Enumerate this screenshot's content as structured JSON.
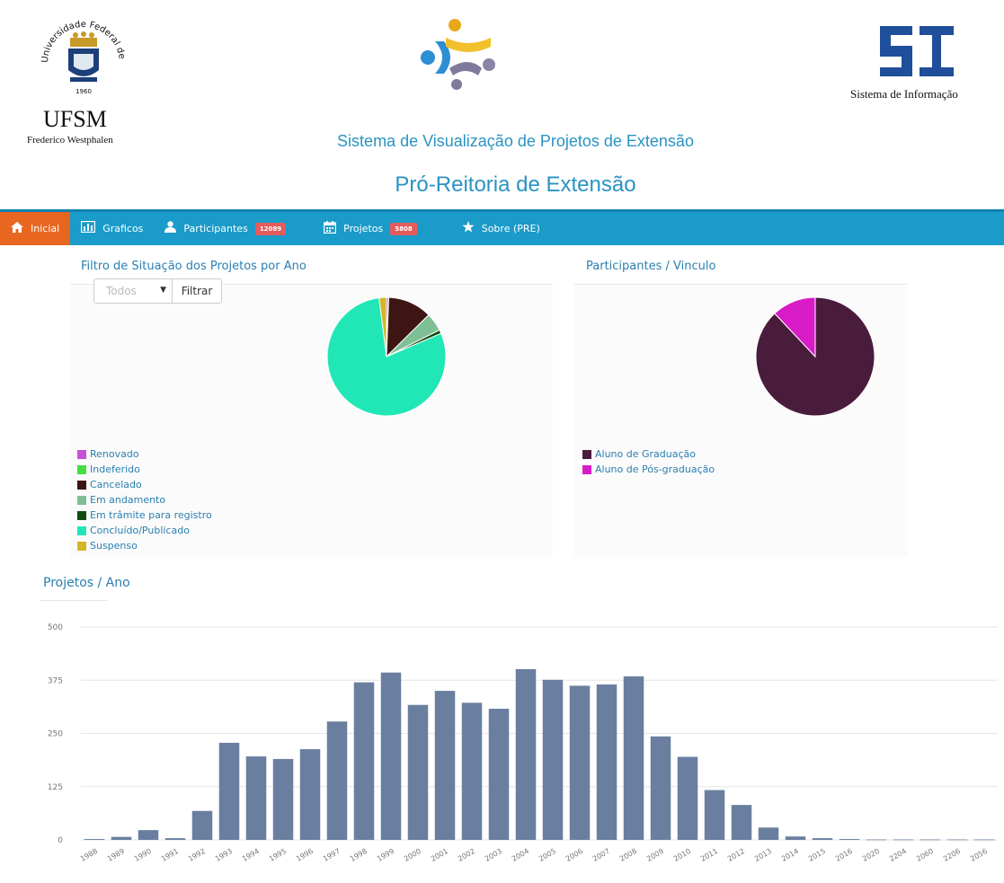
{
  "header": {
    "ufsm_title": "UFSM",
    "ufsm_campus": "Frederico Westphalen",
    "ufsm_seal_text": "Universidade Federal de Santa Maria",
    "ufsm_seal_year": "1960",
    "si_caption": "Sistema de Informação",
    "system_title": "Sistema de Visualização de Projetos de Extensão",
    "system_subtitle": "Pró-Reitoria de Extensão"
  },
  "navbar": {
    "items": [
      {
        "label": "Inicial",
        "icon": "home-icon",
        "active": true
      },
      {
        "label": "Graficos",
        "icon": "chart-icon"
      },
      {
        "label": "Participantes",
        "icon": "user-icon",
        "badge": "12089"
      },
      {
        "label": "Projetos",
        "icon": "calendar-icon",
        "badge": "5808"
      },
      {
        "label": "Sobre (PRE)",
        "icon": "star-icon"
      }
    ],
    "colors": {
      "bar": "#1a9bc9",
      "active": "#e8661f",
      "badge": "#e45c5c"
    }
  },
  "situacao_panel": {
    "title": "Filtro de Situação dos Projetos por Ano",
    "select_value": "Todos",
    "filter_button": "Filtrar"
  },
  "vinculo_panel": {
    "title": "Participantes / Vinculo"
  },
  "anos_panel": {
    "title": "Projetos / Ano"
  },
  "chart_data": [
    {
      "type": "pie",
      "labels": [
        "Renovado",
        "Indeferido",
        "Cancelado",
        "Em andamento",
        "Em trâmite para registro",
        "Concluído/Publicado",
        "Suspenso"
      ],
      "values": [
        0.5,
        0.1,
        12,
        5,
        1,
        79.4,
        2
      ],
      "colors": [
        "#c94fd6",
        "#44dd44",
        "#3d1613",
        "#7fbf96",
        "#0e4d0e",
        "#21e7b6",
        "#d4b626"
      ],
      "legend": "bottom-left"
    },
    {
      "type": "pie",
      "labels": [
        "Aluno de Graduação",
        "Aluno de Pós-graduação"
      ],
      "values": [
        88,
        12
      ],
      "colors": [
        "#4a1c3c",
        "#d91bc7"
      ],
      "legend": "bottom-left"
    },
    {
      "type": "bar",
      "categories": [
        "1988",
        "1989",
        "1990",
        "1991",
        "1992",
        "1993",
        "1994",
        "1995",
        "1996",
        "1997",
        "1998",
        "1999",
        "2000",
        "2001",
        "2002",
        "2003",
        "2004",
        "2005",
        "2006",
        "2007",
        "2008",
        "2009",
        "2010",
        "2011",
        "2012",
        "2013",
        "2014",
        "2015",
        "2016",
        "2020",
        "2204",
        "2060",
        "2206",
        "2056"
      ],
      "values": [
        2,
        7,
        23,
        4,
        68,
        228,
        196,
        190,
        213,
        278,
        370,
        393,
        317,
        350,
        322,
        308,
        401,
        376,
        362,
        365,
        384,
        243,
        195,
        117,
        82,
        29,
        8,
        4,
        2,
        1,
        1,
        1,
        1,
        1
      ],
      "ylim": [
        0,
        500
      ],
      "yticks": [
        0,
        125,
        250,
        375,
        500
      ],
      "grid": true,
      "color": "#6a7f9f"
    }
  ]
}
